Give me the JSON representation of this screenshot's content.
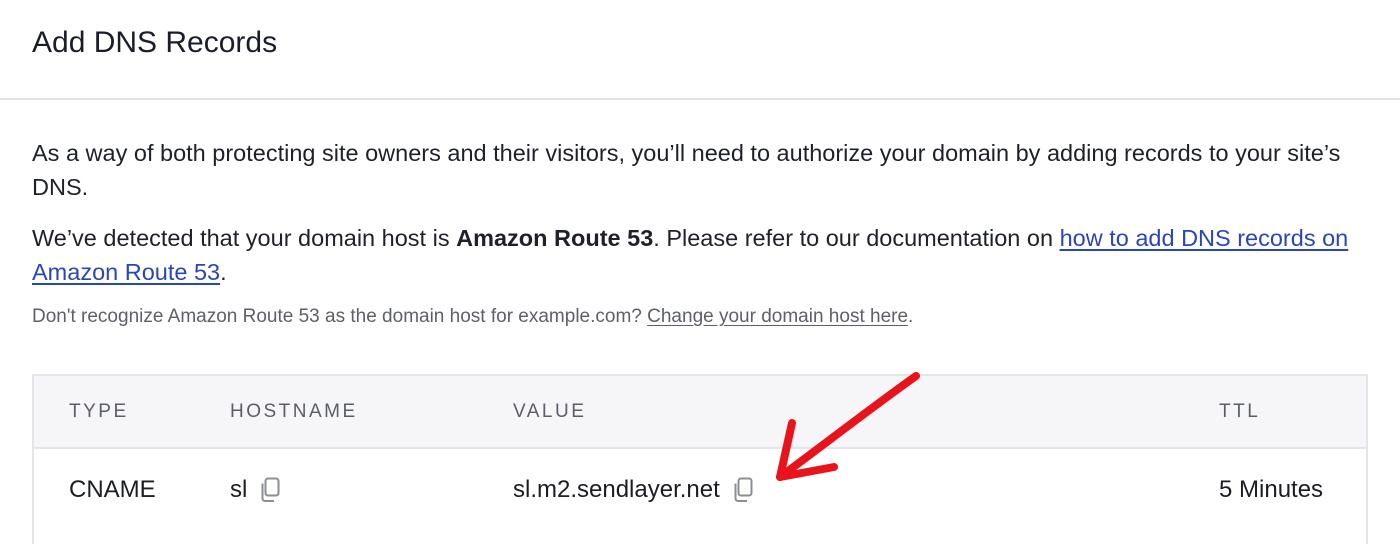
{
  "header": {
    "title": "Add DNS Records"
  },
  "intro": {
    "text": "As a way of both protecting site owners and their visitors, you’ll need to authorize your domain by adding records to your site’s DNS."
  },
  "detected": {
    "prefix": "We’ve detected that your domain host is ",
    "host_name": "Amazon Route 53",
    "middle": ". Please refer to our documentation on ",
    "link_text": "how to add DNS records on Amazon Route 53",
    "suffix": "."
  },
  "note": {
    "prefix": "Don't recognize Amazon Route 53 as the domain host for example.com? ",
    "link_text": "Change your domain host here",
    "suffix": "."
  },
  "table": {
    "columns": [
      "TYPE",
      "HOSTNAME",
      "VALUE",
      "TTL"
    ],
    "rows": [
      {
        "type": "CNAME",
        "hostname": "sl",
        "value": "sl.m2.sendlayer.net",
        "ttl": "5 Minutes"
      }
    ]
  },
  "icons": {
    "copy": "copy-icon",
    "annotation": "red-arrow-annotation"
  },
  "colors": {
    "link": "#2a46b8",
    "arrow": "#e8131b",
    "table_header_bg": "#f6f6f8"
  }
}
